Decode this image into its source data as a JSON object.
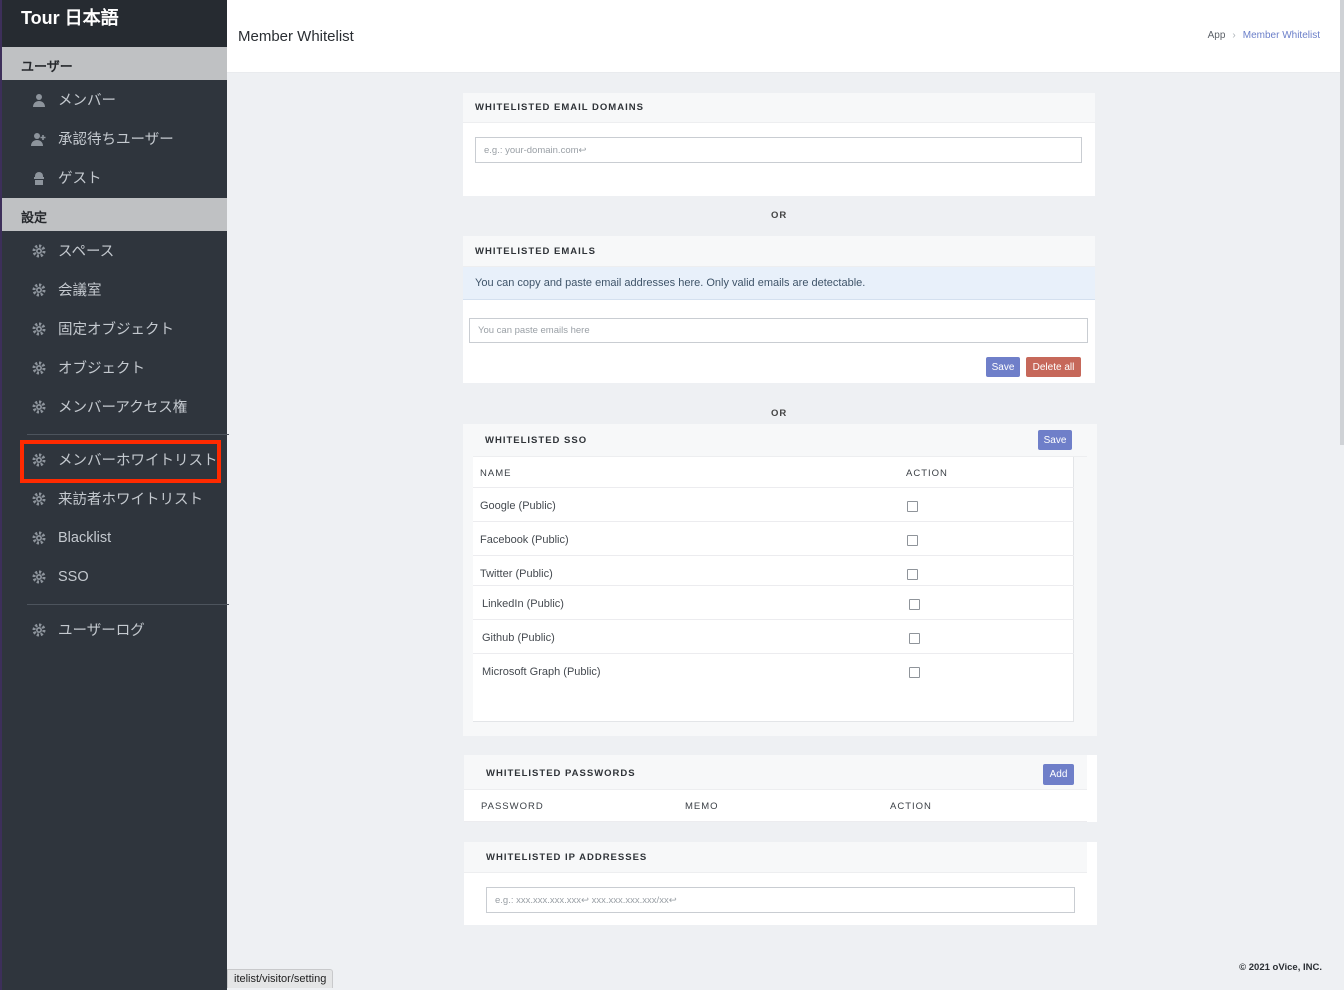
{
  "sidebar": {
    "brand": "Tour 日本語",
    "section_users": "ユーザー",
    "section_settings": "設定",
    "items_users": [
      {
        "label": "メンバー",
        "icon": "user-icon"
      },
      {
        "label": "承認待ちユーザー",
        "icon": "user-plus-icon"
      },
      {
        "label": "ゲスト",
        "icon": "guest-icon"
      }
    ],
    "items_settings": [
      {
        "label": "スペース",
        "icon": "gear-icon"
      },
      {
        "label": "会議室",
        "icon": "gear-icon"
      },
      {
        "label": "固定オブジェクト",
        "icon": "gear-icon"
      },
      {
        "label": "オブジェクト",
        "icon": "gear-icon"
      },
      {
        "label": "メンバーアクセス権",
        "icon": "gear-icon"
      }
    ],
    "items_whitelist": [
      {
        "label": "メンバーホワイトリスト",
        "icon": "gear-icon"
      },
      {
        "label": "来訪者ホワイトリスト",
        "icon": "gear-icon"
      },
      {
        "label": "Blacklist",
        "icon": "gear-icon"
      },
      {
        "label": "SSO",
        "icon": "gear-icon"
      }
    ],
    "items_logs": [
      {
        "label": "ユーザーログ",
        "icon": "gear-icon"
      }
    ]
  },
  "header": {
    "title": "Member Whitelist",
    "breadcrumb_root": "App",
    "breadcrumb_current": "Member Whitelist"
  },
  "email_domains": {
    "title": "WHITELISTED EMAIL DOMAINS",
    "placeholder": "e.g.: your-domain.com↩"
  },
  "or_label": "OR",
  "emails": {
    "title": "WHITELISTED EMAILS",
    "info": "You can copy and paste email addresses here. Only valid emails are detectable.",
    "placeholder": "You can paste emails here",
    "save_label": "Save",
    "delete_all_label": "Delete all"
  },
  "sso": {
    "title": "WHITELISTED SSO",
    "save_label": "Save",
    "col_name": "NAME",
    "col_action": "ACTION",
    "rows": [
      {
        "name": "Google (Public)"
      },
      {
        "name": "Facebook (Public)"
      },
      {
        "name": "Twitter (Public)"
      },
      {
        "name": "LinkedIn (Public)"
      },
      {
        "name": "Github (Public)"
      },
      {
        "name": "Microsoft Graph (Public)"
      }
    ]
  },
  "passwords": {
    "title": "WHITELISTED PASSWORDS",
    "add_label": "Add",
    "col_password": "PASSWORD",
    "col_memo": "MEMO",
    "col_action": "ACTION"
  },
  "ip": {
    "title": "WHITELISTED IP ADDRESSES",
    "placeholder": "e.g.: xxx.xxx.xxx.xxx↩ xxx.xxx.xxx.xxx/xx↩"
  },
  "footer": {
    "copyright": "© 2021 oVice, INC.",
    "status_url": "itelist/visitor/setting"
  },
  "colors": {
    "sidebar_bg": "#2f353d",
    "accent_blue": "#6f7fc9",
    "danger_red": "#c6685a",
    "highlight": "#ff2a00"
  }
}
